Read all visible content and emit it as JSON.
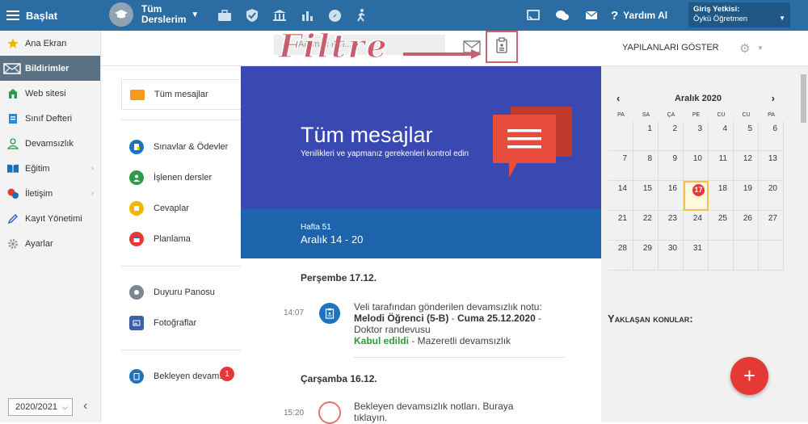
{
  "topbar": {
    "start_label": "Başlat",
    "course_line1": "Tüm",
    "course_line2": "Derslerim",
    "help_label": "Yardım Al",
    "role_title": "Giriş Yetkisi:",
    "role_value": "Öykü Öğretmen",
    "icons": [
      "briefcase-icon",
      "shield-icon",
      "bank-icon",
      "chart-icon",
      "compass-icon",
      "walking-icon"
    ]
  },
  "sidebar": {
    "items": [
      {
        "label": "Ana Ekran",
        "icon": "star-icon"
      },
      {
        "label": "Bildirimler",
        "icon": "envelope-icon"
      },
      {
        "label": "Web sitesi",
        "icon": "home-icon"
      },
      {
        "label": "Sınıf Defteri",
        "icon": "book-icon"
      },
      {
        "label": "Devamsızlık",
        "icon": "person-icon"
      },
      {
        "label": "Eğitim",
        "icon": "open-book-icon"
      },
      {
        "label": "İletişim",
        "icon": "chat-icon"
      },
      {
        "label": "Kayıt Yönetimi",
        "icon": "pen-icon"
      },
      {
        "label": "Ayarlar",
        "icon": "gear-icon"
      }
    ],
    "year": "2020/2021",
    "collapse": "‹"
  },
  "toolbar": {
    "search_placeholder": "Aramak için...",
    "show_done": "YAPILANLARI GÖSTER",
    "filter_annotation": "Filtre"
  },
  "msgnav": {
    "all": "Tüm mesajlar",
    "exams": "Sınavlar & Ödevler",
    "lessons": "İşlenen dersler",
    "answers": "Cevaplar",
    "planning": "Planlama",
    "board": "Duyuru Panosu",
    "photos": "Fotoğraflar",
    "pending": "Bekleyen devams",
    "pending_count": "1"
  },
  "banner": {
    "title": "Tüm mesajlar",
    "subtitle": "Yenilikleri ve yapmanız gerekenleri kontrol edin"
  },
  "week": {
    "label": "Hafta 51",
    "range": "Aralık 14 - 20"
  },
  "feed": {
    "day1": "Perşembe 17.12.",
    "time1": "14:07",
    "entry1_line1": "Veli tarafından gönderilen devamsızlık notu:",
    "entry1_student": "Melodi Öğrenci (5-B)",
    "entry1_sep": " - ",
    "entry1_date": "Cuma 25.12.2020",
    "entry1_dash": " -",
    "entry1_reason": "Doktor randevusu",
    "entry1_status": "Kabul edildi",
    "entry1_status_rest": " - Mazeretli devamsızlık",
    "day2": "Çarşamba 16.12.",
    "time2": "15:20",
    "entry2_line1": "Bekleyen devamsızlık notları. Buraya",
    "entry2_line2": "tıklayın."
  },
  "calendar": {
    "month": "Aralık 2020",
    "prev": "‹",
    "next": "›",
    "day_names": [
      "PA",
      "SA",
      "ÇA",
      "PE",
      "CU",
      "CU",
      "PA"
    ],
    "weeks": [
      [
        "",
        "1",
        "2",
        "3",
        "4",
        "5",
        "6"
      ],
      [
        "7",
        "8",
        "9",
        "10",
        "11",
        "12",
        "13"
      ],
      [
        "14",
        "15",
        "16",
        "17",
        "18",
        "19",
        "20"
      ],
      [
        "21",
        "22",
        "23",
        "24",
        "25",
        "26",
        "27"
      ],
      [
        "28",
        "29",
        "30",
        "31",
        "",
        "",
        ""
      ]
    ],
    "today": "17"
  },
  "upcoming_title": "Yaklaşan konular:",
  "fab_label": "+",
  "colors": {
    "topbar": "#2b6ca3",
    "banner": "#3a48b2",
    "week": "#1d64ad",
    "annotation": "#c95f6e",
    "badge": "#e53935"
  }
}
